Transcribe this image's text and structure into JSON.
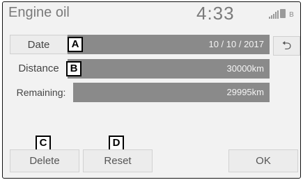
{
  "header": {
    "title": "Engine oil",
    "time": "4:33",
    "signal_icon": "signal-icon",
    "battery_icon": "battery-icon",
    "bt_icon": "bluetooth-icon"
  },
  "rows": [
    {
      "label": "Date",
      "value": "10 / 10 / 2017",
      "callout": "A"
    },
    {
      "label": "Distance",
      "value": "30000km",
      "callout": "B"
    },
    {
      "label": "Remaining:",
      "value": "29995km"
    }
  ],
  "back_icon": "return-arrow-icon",
  "buttons": {
    "delete": "Delete",
    "reset": "Reset",
    "ok": "OK",
    "delete_callout": "C",
    "reset_callout": "D"
  },
  "colors": {
    "bar": "#8a8a8a",
    "panel": "#f2f2f2"
  }
}
